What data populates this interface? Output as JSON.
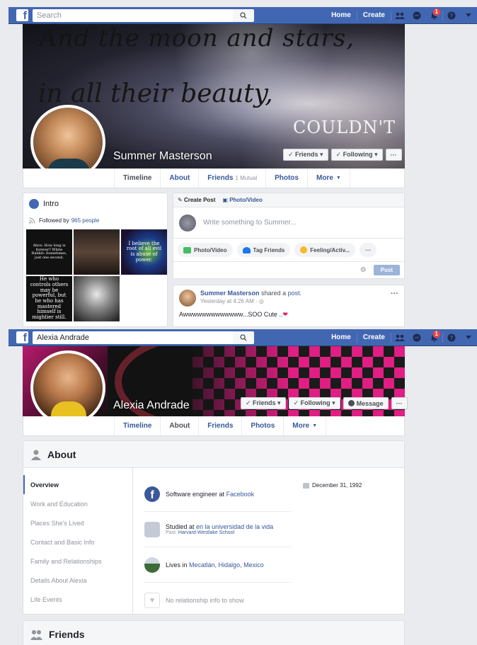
{
  "profile1": {
    "search_placeholder": "Search",
    "nav": {
      "home": "Home",
      "create": "Create",
      "notif_count": "1"
    },
    "cover_quote": {
      "line1": "And the moon and stars,",
      "line2": "in all their beauty,",
      "line3": "COULDN'T"
    },
    "name": "Summer Masterson",
    "buttons": {
      "friends": "✓ Friends ▾",
      "following": "✓ Following ▾",
      "more": "···"
    },
    "tabs": [
      {
        "label": "Timeline"
      },
      {
        "label": "About"
      },
      {
        "label": "Friends",
        "sub": "1 Mutual"
      },
      {
        "label": "Photos"
      },
      {
        "label": "More"
      }
    ],
    "intro": {
      "title": "Intro",
      "followed_prefix": "Followed by",
      "followed_link": "965 people",
      "photo_texts": [
        "Alice: How long is forever? White Rabbit: Sometimes, just one second.",
        "",
        "I believe the root of all evil is abuse of power.",
        "He who controls others may be powerful, but he who has mastered himself is mightier still.",
        ""
      ]
    },
    "composer": {
      "create_post": "Create Post",
      "photo_video_tab": "Photo/Video",
      "placeholder": "Write something to Summer...",
      "actions": [
        "Photo/Video",
        "Tag Friends",
        "Feeling/Activ...",
        "···"
      ],
      "post_label": "Post"
    },
    "post": {
      "author": "Summer Masterson",
      "shared": "shared a",
      "object": "post.",
      "time": "Yesterday at 4:26 AM · ",
      "text": "Awwwwwwwwwwwww...SOO Cute .."
    }
  },
  "profile2": {
    "search_value": "Alexia Andrade",
    "nav": {
      "home": "Home",
      "create": "Create",
      "notif_count": "1"
    },
    "name": "Alexia Andrade",
    "buttons": {
      "friends": "✓ Friends ▾",
      "following": "✓ Following ▾",
      "message": "Message",
      "more": "···"
    },
    "tabs": [
      {
        "label": "Timeline"
      },
      {
        "label": "About"
      },
      {
        "label": "Friends"
      },
      {
        "label": "Photos"
      },
      {
        "label": "More"
      }
    ],
    "about": {
      "title": "About",
      "nav": [
        "Overview",
        "Work and Education",
        "Places She's Lived",
        "Contact and Basic Info",
        "Family and Relationships",
        "Details About Alexia",
        "Life Events"
      ],
      "work_prefix": "Software engineer at",
      "work_link": "Facebook",
      "study_prefix": "Studied at",
      "study_link": "en la universidad de la vida",
      "past_prefix": "Past:",
      "past_link": "Harvard-Westlake School",
      "lives_prefix": "Lives in",
      "lives_link": "Mecatlán, Hidalgo, Mexico",
      "relationship": "No relationship info to show",
      "birthday": "December 31, 1992"
    },
    "friends_title": "Friends"
  },
  "colors": {
    "fb_blue": "#4267b2",
    "link": "#365899",
    "notification": "#fa3e3e"
  }
}
